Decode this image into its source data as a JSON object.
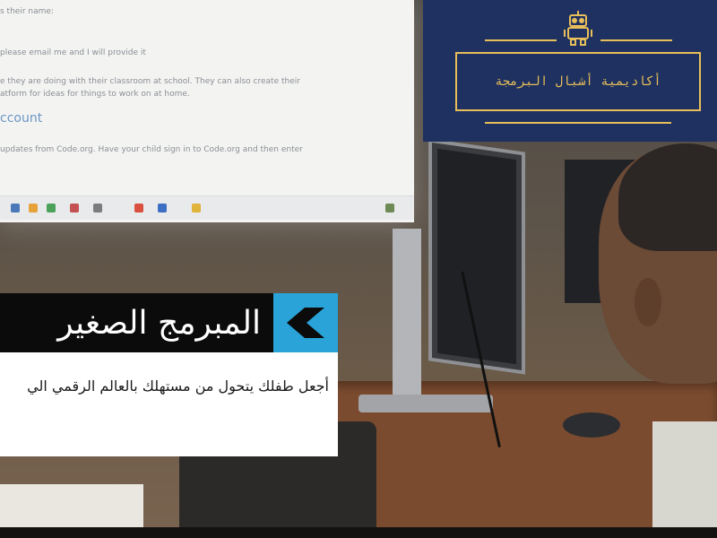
{
  "brand": {
    "name": "أكاديمية أشبال البرمجة",
    "icon": "robot-icon",
    "panel_color": "#1e3160",
    "accent_color": "#e8be5a"
  },
  "banner": {
    "title": "المبرمج الصغير",
    "tagline": "أجعل طفلك يتحول من مستهلك بالعالم الرقمي الي",
    "chevron_icon": "chevron-left-icon",
    "accent_color": "#29a3d8"
  },
  "projection": {
    "lines": [
      "s their name:",
      "please email me and I will provide it",
      "e they are doing with their classroom at school. They can also create their",
      "atform for ideas for things to work on at home.",
      "updates from Code.org. Have your child sign in to Code.org and then enter"
    ],
    "heading": "ccount"
  }
}
